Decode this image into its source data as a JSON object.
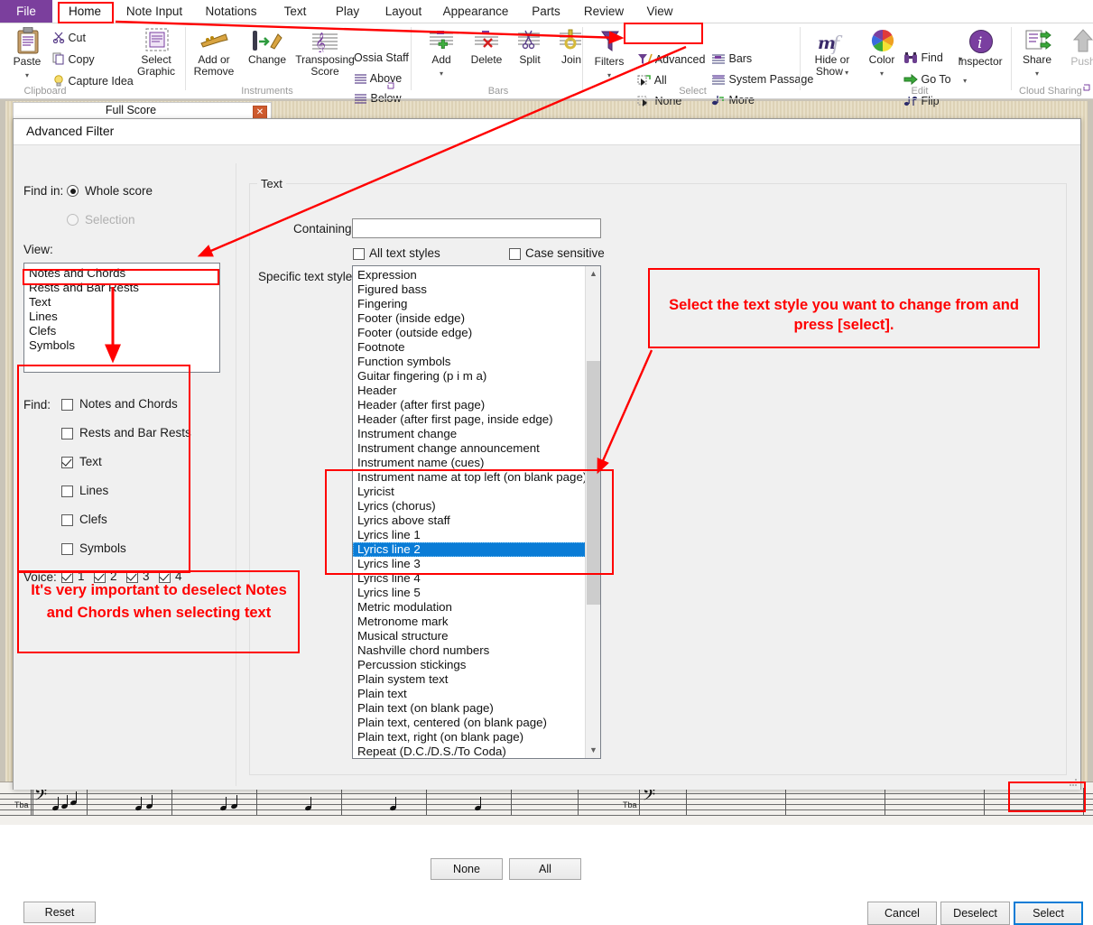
{
  "ribbon": {
    "tabs": [
      {
        "label": "File"
      },
      {
        "label": "Home"
      },
      {
        "label": "Note Input"
      },
      {
        "label": "Notations"
      },
      {
        "label": "Text"
      },
      {
        "label": "Play"
      },
      {
        "label": "Layout"
      },
      {
        "label": "Appearance"
      },
      {
        "label": "Parts"
      },
      {
        "label": "Review"
      },
      {
        "label": "View"
      }
    ],
    "groups": [
      {
        "name": "Clipboard",
        "label": "Clipboard"
      },
      {
        "name": "Instruments",
        "label": "Instruments"
      },
      {
        "name": "Bars",
        "label": "Bars"
      },
      {
        "name": "Select",
        "label": "Select"
      },
      {
        "name": "Edit",
        "label": "Edit"
      },
      {
        "name": "CloudSharing",
        "label": "Cloud Sharing"
      }
    ],
    "clipboard": {
      "paste": "Paste",
      "cut": "Cut",
      "copy": "Copy",
      "capture_idea": "Capture Idea",
      "select_graphic_l1": "Select",
      "select_graphic_l2": "Graphic"
    },
    "instruments": {
      "add_or_remove_l1": "Add or",
      "add_or_remove_l2": "Remove",
      "change": "Change",
      "transposing_l1": "Transposing",
      "transposing_l2": "Score",
      "ossia_staff": "Ossia Staff",
      "above": "Above",
      "below": "Below"
    },
    "bars": {
      "add": "Add",
      "delete": "Delete",
      "split": "Split",
      "join": "Join"
    },
    "select": {
      "filters": "Filters",
      "advanced": "Advanced",
      "all": "All",
      "none": "None",
      "bars": "Bars",
      "system_passage": "System Passage",
      "more": "More"
    },
    "edit": {
      "hide_or_show_l1": "Hide or",
      "hide_or_show_l2": "Show",
      "color": "Color",
      "find": "Find",
      "go_to": "Go To",
      "flip": "Flip",
      "inspector": "Inspector"
    },
    "cloud": {
      "share": "Share",
      "push": "Push"
    }
  },
  "doc_tab": {
    "title": "Full Score",
    "close": "✕"
  },
  "dialog": {
    "title": "Advanced Filter",
    "find_in_label": "Find in:",
    "find_in_options": [
      {
        "label": "Whole score",
        "selected": true,
        "enabled": true
      },
      {
        "label": "Selection",
        "selected": false,
        "enabled": false
      }
    ],
    "view_label": "View:",
    "view_items": [
      {
        "label": "Notes and Chords"
      },
      {
        "label": "Rests and Bar Rests"
      },
      {
        "label": "Text"
      },
      {
        "label": "Lines"
      },
      {
        "label": "Clefs"
      },
      {
        "label": "Symbols"
      }
    ],
    "find_label": "Find:",
    "find_checks": [
      {
        "label": "Notes and Chords",
        "checked": false
      },
      {
        "label": "Rests and Bar Rests",
        "checked": false
      },
      {
        "label": "Text",
        "checked": true
      },
      {
        "label": "Lines",
        "checked": false
      },
      {
        "label": "Clefs",
        "checked": false
      },
      {
        "label": "Symbols",
        "checked": false
      }
    ],
    "voice_label": "Voice:",
    "voices": [
      {
        "label": "1",
        "checked": true
      },
      {
        "label": "2",
        "checked": true
      },
      {
        "label": "3",
        "checked": true
      },
      {
        "label": "4",
        "checked": true
      }
    ],
    "text_group_title": "Text",
    "containing_label": "Containing:",
    "containing_value": "",
    "containing_placeholder": "",
    "all_text_styles": {
      "label": "All text styles",
      "checked": false
    },
    "case_sensitive": {
      "label": "Case sensitive",
      "checked": false
    },
    "specific_text_styles_label": "Specific text styles:",
    "text_styles": [
      {
        "label": "Expression",
        "selected": false
      },
      {
        "label": "Figured bass",
        "selected": false
      },
      {
        "label": "Fingering",
        "selected": false
      },
      {
        "label": "Footer (inside edge)",
        "selected": false
      },
      {
        "label": "Footer (outside edge)",
        "selected": false
      },
      {
        "label": "Footnote",
        "selected": false
      },
      {
        "label": "Function symbols",
        "selected": false
      },
      {
        "label": "Guitar fingering (p i m a)",
        "selected": false
      },
      {
        "label": "Header",
        "selected": false
      },
      {
        "label": "Header (after first page)",
        "selected": false
      },
      {
        "label": "Header (after first page, inside edge)",
        "selected": false
      },
      {
        "label": "Instrument change",
        "selected": false
      },
      {
        "label": "Instrument change announcement",
        "selected": false
      },
      {
        "label": "Instrument name (cues)",
        "selected": false
      },
      {
        "label": "Instrument name at top left (on blank page)",
        "selected": false
      },
      {
        "label": "Lyricist",
        "selected": false
      },
      {
        "label": "Lyrics (chorus)",
        "selected": false
      },
      {
        "label": "Lyrics above staff",
        "selected": false
      },
      {
        "label": "Lyrics line 1",
        "selected": false
      },
      {
        "label": "Lyrics line 2",
        "selected": true
      },
      {
        "label": "Lyrics line 3",
        "selected": false
      },
      {
        "label": "Lyrics line 4",
        "selected": false
      },
      {
        "label": "Lyrics line 5",
        "selected": false
      },
      {
        "label": "Metric modulation",
        "selected": false
      },
      {
        "label": "Metronome mark",
        "selected": false
      },
      {
        "label": "Musical structure",
        "selected": false
      },
      {
        "label": "Nashville chord numbers",
        "selected": false
      },
      {
        "label": "Percussion stickings",
        "selected": false
      },
      {
        "label": "Plain system text",
        "selected": false
      },
      {
        "label": "Plain text",
        "selected": false
      },
      {
        "label": "Plain text (on blank page)",
        "selected": false
      },
      {
        "label": "Plain text, centered (on blank page)",
        "selected": false
      },
      {
        "label": "Plain text, right (on blank page)",
        "selected": false
      },
      {
        "label": "Repeat (D.C./D.S./To Coda)",
        "selected": false
      }
    ],
    "styles_none_button": "None",
    "styles_all_button": "All",
    "reset_button": "Reset",
    "cancel_button": "Cancel",
    "deselect_button": "Deselect",
    "select_button": "Select"
  },
  "annotations": {
    "callout_right": "Select the text style you want to change from and press [select].",
    "callout_left": "It's very important to deselect Notes and Chords when selecting text",
    "color": "#ff0000"
  },
  "colors": {
    "file_tab": "#7b3f9d",
    "annotation_red": "#ff0000",
    "selection_blue": "#0a7cd6",
    "dialog_bg": "#f0f0f0",
    "close_button": "#cf5b2e"
  },
  "score": {
    "instrument_label": "Tba"
  }
}
